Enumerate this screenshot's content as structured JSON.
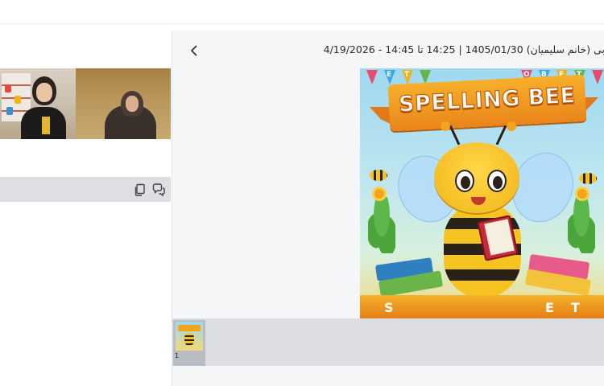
{
  "session": {
    "title": "بی (خانم سلیمیان) 1405/01/30 | 14:25 تا 14:45 - 4/19/2026"
  },
  "slide": {
    "headline": "SPELLING BEE",
    "bunting_letters": [
      "E",
      "T",
      "O",
      "B",
      "F",
      "T"
    ],
    "ribbon_letters": [
      "S",
      "E",
      "T"
    ]
  },
  "thumbnails": [
    {
      "number": "1"
    }
  ],
  "icons": {
    "back": "chevron-right-icon",
    "copy": "copy-icon",
    "chat": "chat-icon"
  }
}
